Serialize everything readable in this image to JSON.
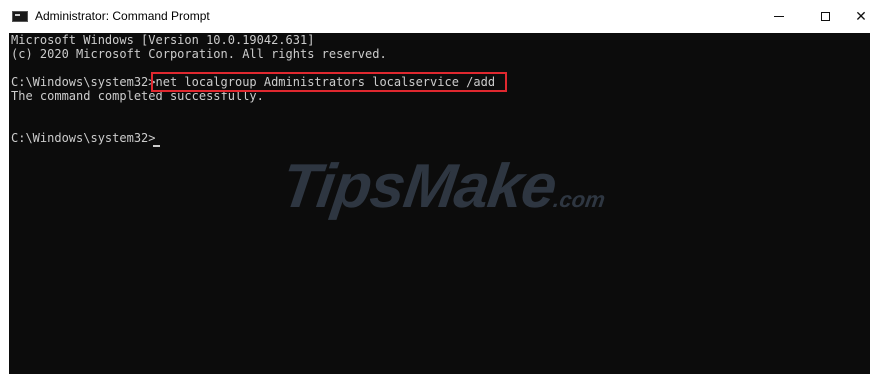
{
  "window": {
    "title": "Administrator: Command Prompt",
    "icon": "cmd-icon",
    "controls": {
      "minimize": "minimize-icon",
      "maximize": "maximize-icon",
      "close": "✕"
    }
  },
  "console": {
    "lines": [
      "Microsoft Windows [Version 10.0.19042.631]",
      "(c) 2020 Microsoft Corporation. All rights reserved.",
      "C:\\Windows\\system32>net localgroup Administrators localservice /add",
      "The command completed successfully.",
      "C:\\Windows\\system32>"
    ],
    "highlighted_command": "net localgroup Administrators localservice /add",
    "text_color": "#cccccc",
    "background": "#0c0c0c",
    "highlight_color": "#e0282f"
  },
  "watermark": {
    "brand": "TipsMake",
    "suffix": ".com"
  }
}
